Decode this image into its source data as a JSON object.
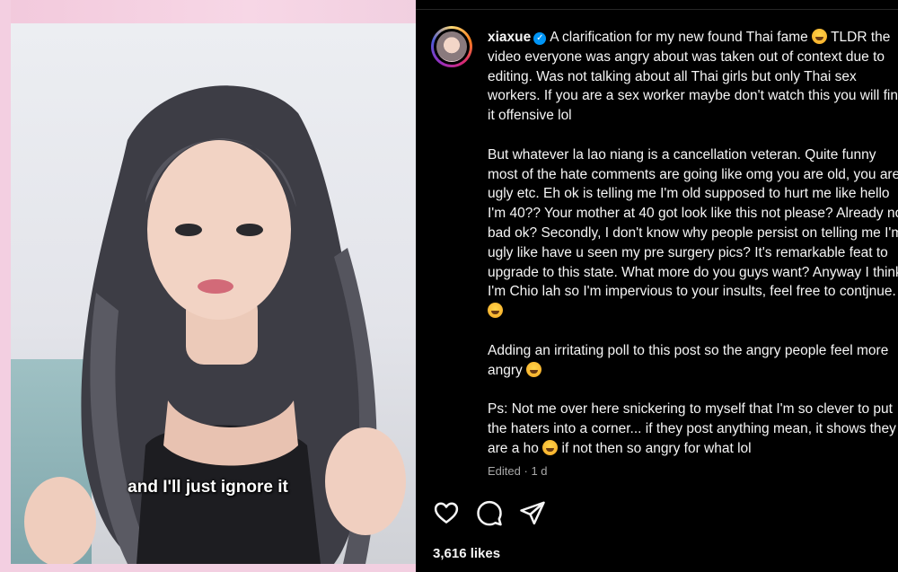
{
  "media": {
    "caption": "and I'll just ignore it"
  },
  "post": {
    "username": "xiaxue",
    "paragraphs": [
      "A clarification for my new found Thai fame",
      "TLDR the video everyone was angry about was taken out of context due to editing. Was not talking about all Thai girls but only Thai sex workers. If you are a sex worker maybe don't watch this you will find it offensive lol",
      "But whatever la lao niang is a cancellation veteran. Quite funny most of the hate comments are going like omg you are old, you are ugly etc. Eh ok is telling me I'm old supposed to hurt me like hello I'm 40?? Your mother at 40 got look like this not please? Already not bad ok? Secondly, I don't know why people persist on telling me I'm ugly like have u seen my pre surgery pics? It's remarkable feat to upgrade to this state. What more do you guys want? Anyway I think I'm Chio lah so I'm impervious to your insults, feel free to contjnue.",
      "Adding an irritating poll to this post so the angry people feel more angry",
      "Ps: Not me over here snickering to myself that I'm so clever to put the haters into a corner... if they post anything mean, it shows they are a ho",
      "if not then so angry for what lol"
    ],
    "edited_label": "Edited",
    "time_ago": "1 d",
    "likes": "3,616 likes"
  },
  "icons": [
    "heart-icon",
    "comment-icon",
    "share-icon",
    "verified-icon"
  ],
  "colors": {
    "background": "#000000",
    "text": "#f5f5f5",
    "secondary_text": "#a8a8a8",
    "verified": "#0095f6"
  }
}
